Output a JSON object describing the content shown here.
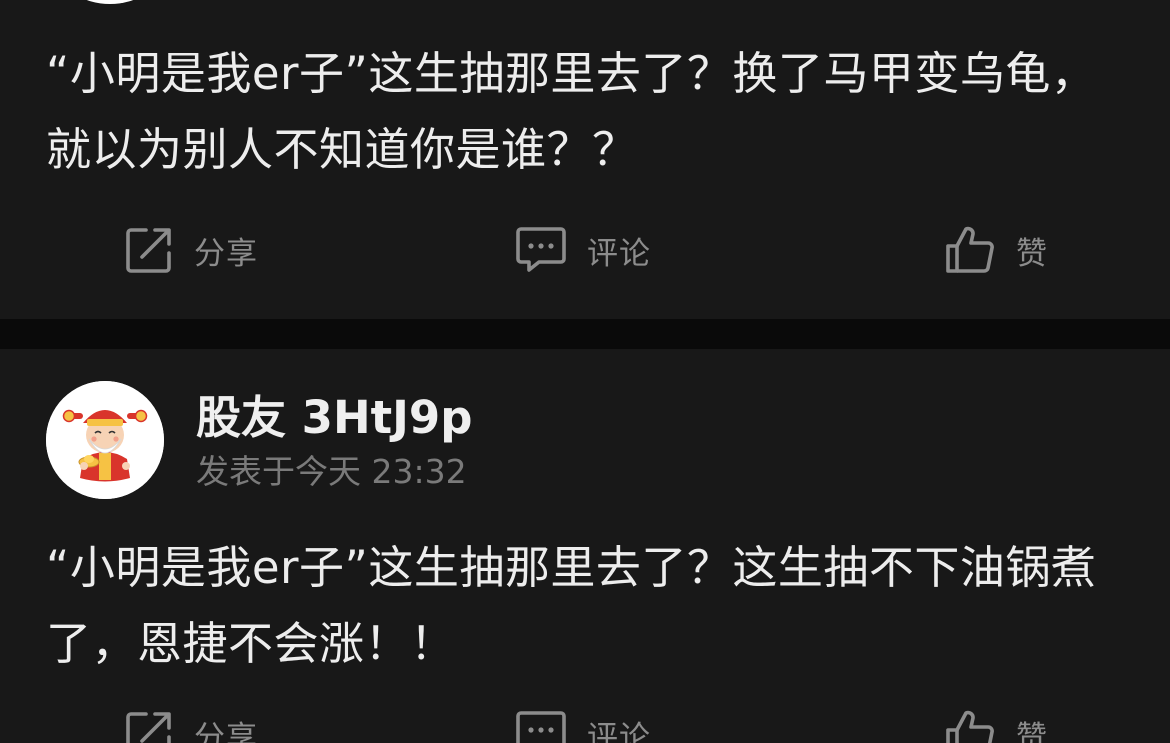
{
  "posts": [
    {
      "content": "“小明是我er子”这生抽那里去了？换了马甲变乌龟，就以为别人不知道你是谁？？",
      "actions": {
        "share_label": "分享",
        "comment_label": "评论",
        "like_label": "赞"
      }
    },
    {
      "username": "股友 3HtJ9p",
      "timestamp": "发表于今天 23:32",
      "content": "“小明是我er子”这生抽那里去了？这生抽不下油锅煮了，恩捷不会涨！！",
      "actions": {
        "share_label": "分享",
        "comment_label": "评论",
        "like_label": "赞"
      }
    }
  ],
  "colors": {
    "background": "#0a0a0a",
    "card": "#181818",
    "text_primary": "#ededed",
    "text_secondary": "#7a7a7a",
    "action_gray": "#8c8c8c"
  },
  "icons": {
    "share": "share-icon",
    "comment": "comment-icon",
    "like": "thumbs-up-icon",
    "avatar": "god-of-wealth-avatar"
  }
}
